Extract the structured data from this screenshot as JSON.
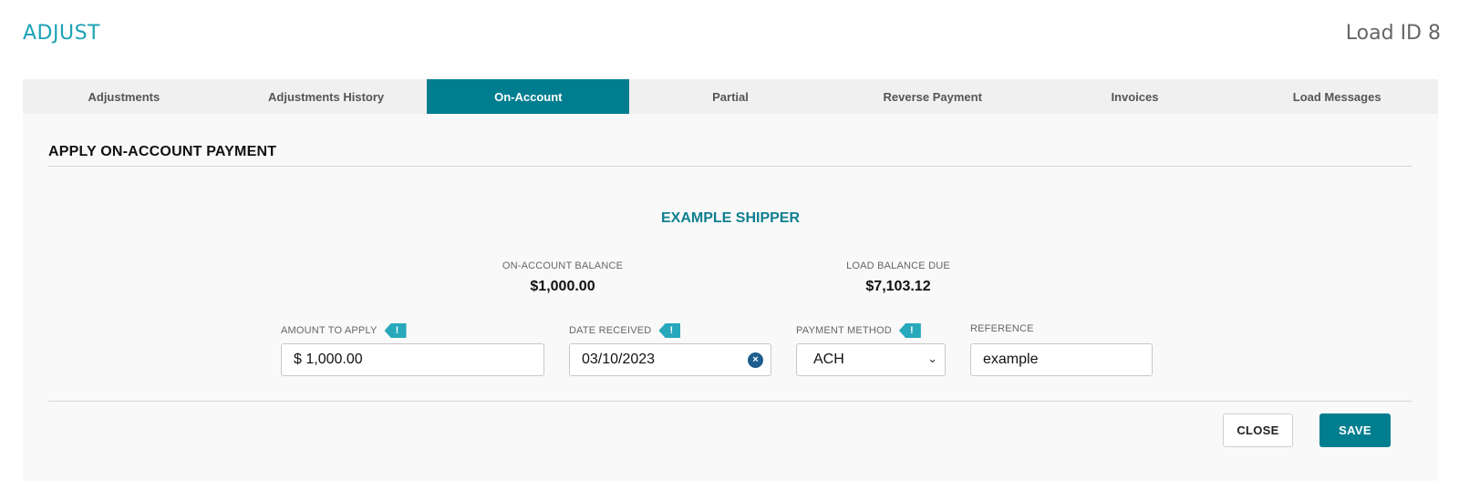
{
  "header": {
    "title": "ADJUST",
    "load_id": "Load ID 8"
  },
  "tabs": [
    {
      "label": "Adjustments",
      "active": false
    },
    {
      "label": "Adjustments History",
      "active": false
    },
    {
      "label": "On-Account",
      "active": true
    },
    {
      "label": "Partial",
      "active": false
    },
    {
      "label": "Reverse Payment",
      "active": false
    },
    {
      "label": "Invoices",
      "active": false
    },
    {
      "label": "Load Messages",
      "active": false
    }
  ],
  "section": {
    "title": "APPLY ON-ACCOUNT PAYMENT"
  },
  "shipper": {
    "name": "EXAMPLE SHIPPER"
  },
  "stats": {
    "on_account_label": "ON-ACCOUNT BALANCE",
    "on_account_value": "$1,000.00",
    "load_balance_label": "LOAD BALANCE DUE",
    "load_balance_value": "$7,103.12"
  },
  "form": {
    "amount": {
      "label": "AMOUNT TO APPLY",
      "value": "$ 1,000.00",
      "flag": "!"
    },
    "date": {
      "label": "DATE RECEIVED",
      "value": "03/10/2023",
      "flag": "!",
      "clear_glyph": "×"
    },
    "method": {
      "label": "PAYMENT METHOD",
      "value": "ACH",
      "flag": "!",
      "arrow_glyph": "⌄"
    },
    "reference": {
      "label": "REFERENCE",
      "value": "example"
    }
  },
  "buttons": {
    "close": "CLOSE",
    "save": "SAVE"
  },
  "colors": {
    "accent": "#007e90",
    "title": "#1ba3b6",
    "flag": "#27a8bb",
    "clear": "#1e5e8f"
  }
}
